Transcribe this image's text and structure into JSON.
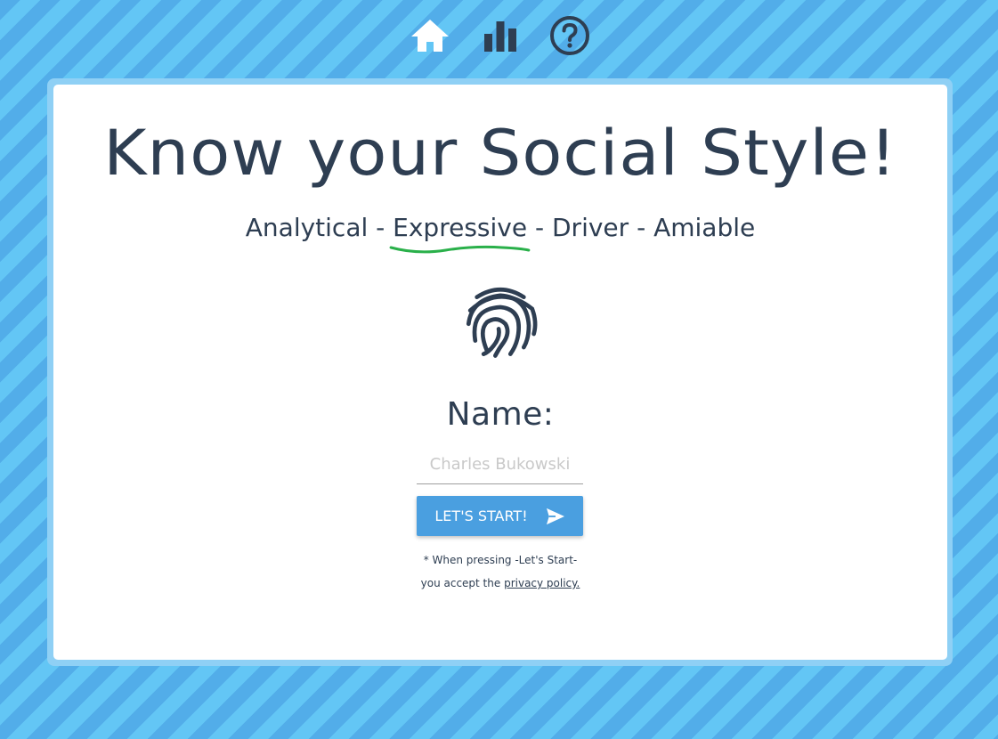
{
  "nav": {
    "items": [
      {
        "id": "home",
        "icon": "home-icon",
        "color": "#ffffff"
      },
      {
        "id": "stats",
        "icon": "bar-chart-icon",
        "color": "#2e3e52"
      },
      {
        "id": "help",
        "icon": "help-circle-icon",
        "color": "#2e3e52"
      }
    ]
  },
  "hero": {
    "title": "Know your Social Style!",
    "styles": {
      "analytical": "Analytical",
      "sep1": " - ",
      "expressive": "Expressive",
      "sep2": " - ",
      "driver": "Driver",
      "sep3": " - ",
      "amiable": "Amiable"
    },
    "highlighted_style": "Expressive",
    "highlight_color": "#2ab04a",
    "icon": "fingerprint-icon"
  },
  "form": {
    "name_label": "Name:",
    "name_value": "",
    "name_placeholder": "Charles Bukowski",
    "start_label": "LET'S START!",
    "start_icon": "send-icon",
    "button_color": "#4a9fe0"
  },
  "footer_note": {
    "line1": "* When pressing -Let's Start-",
    "line2_prefix": "you accept the ",
    "link": "privacy policy."
  },
  "colors": {
    "text": "#2e3e52",
    "background_stripe_a": "#52ade9",
    "background_stripe_b": "#63c6f5",
    "card_border": "#8fd0f5"
  }
}
